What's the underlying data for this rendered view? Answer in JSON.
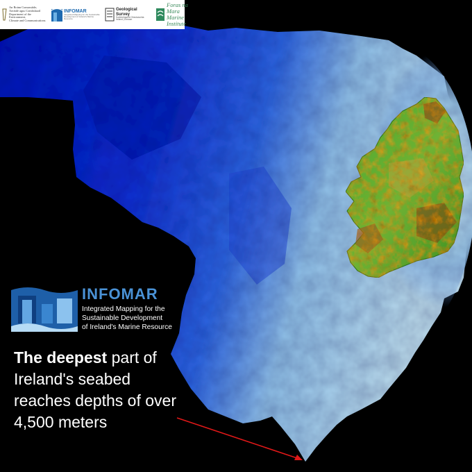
{
  "logos": {
    "department": {
      "lines": [
        "An Roinn Cumarsáide,",
        "Aeráide agus Comhshaoil",
        "Department of the Environment,",
        "Climate and Communications"
      ]
    },
    "infomar_small": {
      "name": "INFOMAR",
      "sub": "Integrated Mapping for the Sustainable Development of Ireland's Marine Resource"
    },
    "gsi": {
      "name": "Geological Survey",
      "sub1": "Suirbhéireacht Gheolaíochta",
      "sub2": "Ireland | Éireann"
    },
    "marine_institute": {
      "lines": [
        "Foras na Mara",
        "Marine Institute"
      ]
    }
  },
  "infomar": {
    "title": "INFOMAR",
    "subtitle_lines": [
      "Integrated Mapping for the",
      "Sustainable Development",
      "of Ireland's Marine Resource"
    ]
  },
  "caption": {
    "lead": "The deepest",
    "rest": " part of Ireland's seabed reaches depths of over 4,500 meters"
  },
  "colors": {
    "deep_sea": "#1428c8",
    "shallow_shelf": "#a8d0e6",
    "land_low": "#3a9c28",
    "land_high": "#8a4a1e",
    "arrow": "#e01818",
    "infomar_blue": "#4a92d6"
  }
}
